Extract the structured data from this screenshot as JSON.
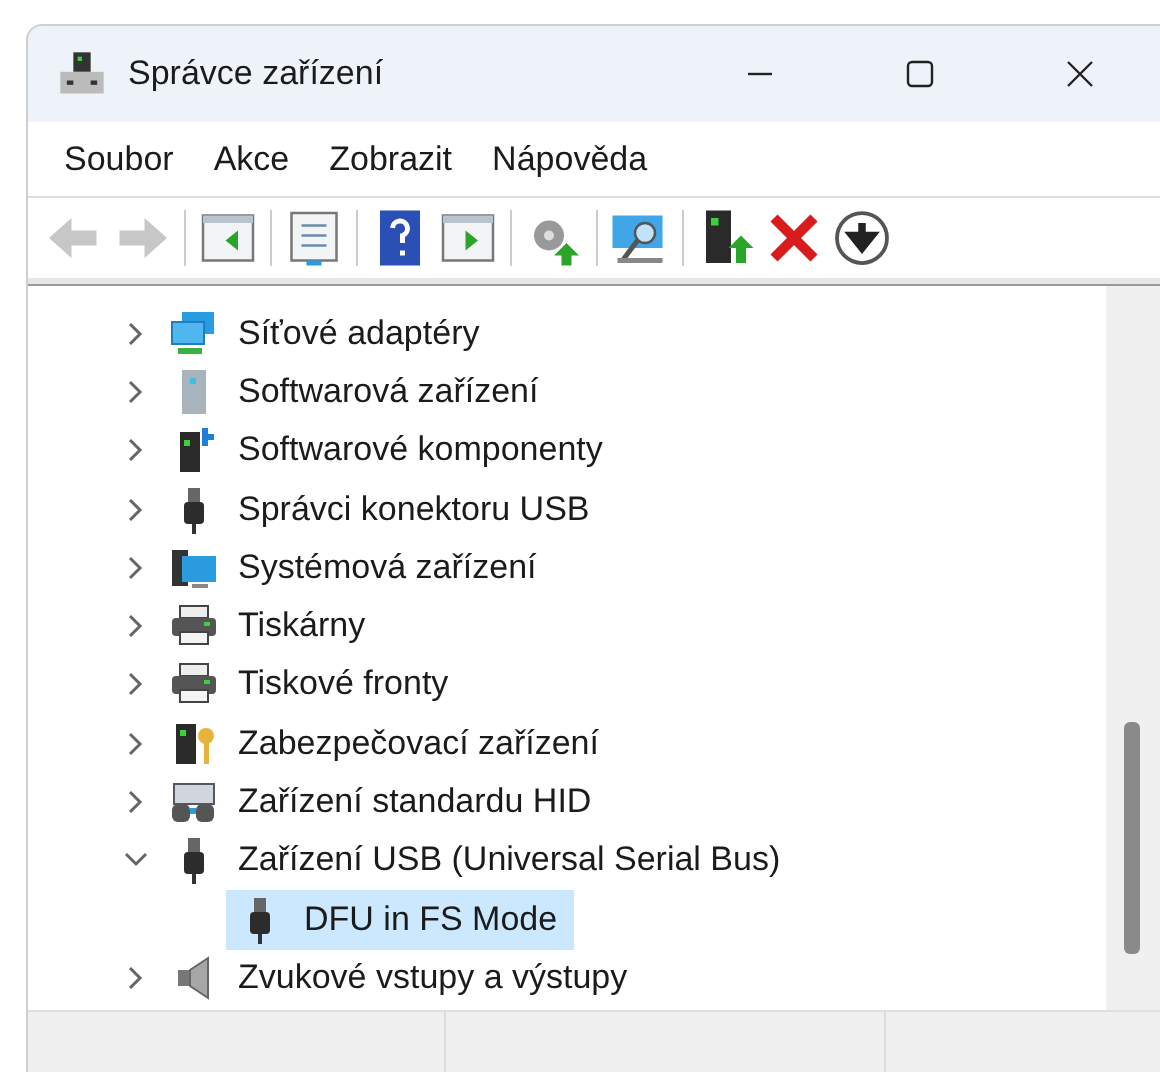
{
  "window": {
    "title": "Správce zařízení"
  },
  "menu": [
    "Soubor",
    "Akce",
    "Zobrazit",
    "Nápověda"
  ],
  "toolbar": [
    {
      "kind": "back",
      "disabled": true
    },
    {
      "kind": "forward",
      "disabled": true
    },
    {
      "kind": "sep"
    },
    {
      "kind": "pane-left",
      "disabled": false
    },
    {
      "kind": "sep"
    },
    {
      "kind": "properties",
      "disabled": false
    },
    {
      "kind": "sep"
    },
    {
      "kind": "help",
      "disabled": false
    },
    {
      "kind": "pane-right",
      "disabled": false
    },
    {
      "kind": "sep"
    },
    {
      "kind": "update",
      "disabled": false
    },
    {
      "kind": "sep"
    },
    {
      "kind": "scan",
      "disabled": false
    },
    {
      "kind": "sep"
    },
    {
      "kind": "enable",
      "disabled": false
    },
    {
      "kind": "remove",
      "disabled": false
    },
    {
      "kind": "download",
      "disabled": false
    }
  ],
  "tree": [
    {
      "label": "Síťové adaptéry",
      "kind": "network",
      "expanded": false,
      "selected": false
    },
    {
      "label": "Softwarová zařízení",
      "kind": "tower",
      "expanded": false,
      "selected": false
    },
    {
      "label": "Softwarové komponenty",
      "kind": "component",
      "expanded": false,
      "selected": false
    },
    {
      "label": "Správci konektoru USB",
      "kind": "usb",
      "expanded": false,
      "selected": false
    },
    {
      "label": "Systémová zařízení",
      "kind": "system",
      "expanded": false,
      "selected": false
    },
    {
      "label": "Tiskárny",
      "kind": "printer",
      "expanded": false,
      "selected": false
    },
    {
      "label": "Tiskové fronty",
      "kind": "printer",
      "expanded": false,
      "selected": false
    },
    {
      "label": "Zabezpečovací zařízení",
      "kind": "security",
      "expanded": false,
      "selected": false
    },
    {
      "label": "Zařízení standardu HID",
      "kind": "hid",
      "expanded": false,
      "selected": false
    },
    {
      "label": "Zařízení USB (Universal Serial Bus)",
      "kind": "usb",
      "expanded": true,
      "selected": false,
      "children": [
        {
          "label": "DFU in FS Mode",
          "kind": "usb",
          "selected": true
        }
      ]
    },
    {
      "label": "Zvukové vstupy a výstupy",
      "kind": "speaker",
      "expanded": false,
      "selected": false
    }
  ]
}
